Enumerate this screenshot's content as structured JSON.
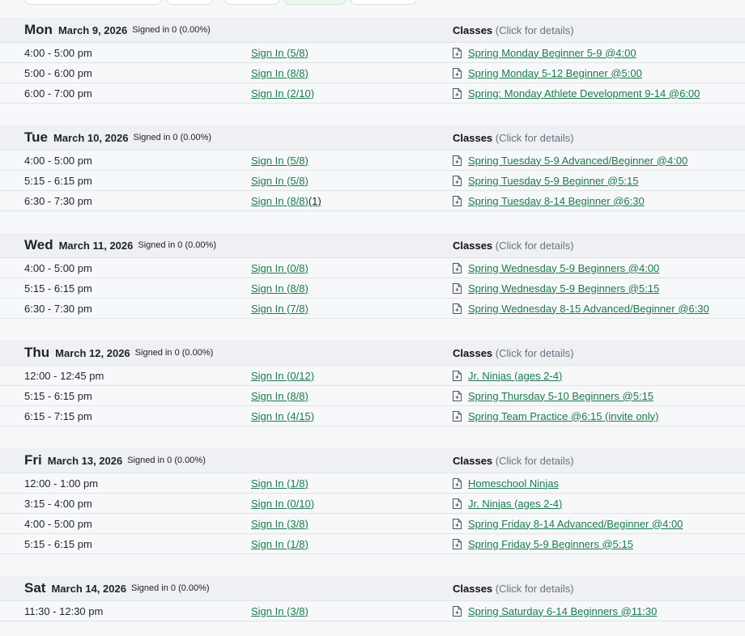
{
  "classes_label": "Classes",
  "classes_hint": "(Click for details)",
  "days": [
    {
      "name": "Mon",
      "date": "March 9, 2026",
      "signed": "Signed in 0 (0.00%)",
      "rows": [
        {
          "time": "4:00 - 5:00 pm",
          "signin": "Sign In (5/8)",
          "extra": "",
          "class": "Spring Monday Beginner 5-9 @4:00"
        },
        {
          "time": "5:00 - 6:00 pm",
          "signin": "Sign In (8/8)",
          "extra": "",
          "class": "Spring Monday 5-12 Beginner @5:00"
        },
        {
          "time": "6:00 - 7:00 pm",
          "signin": "Sign In (2/10)",
          "extra": "",
          "class": "Spring: Monday Athlete Development 9-14 @6:00"
        }
      ]
    },
    {
      "name": "Tue",
      "date": "March 10, 2026",
      "signed": "Signed in 0 (0.00%)",
      "rows": [
        {
          "time": "4:00 - 5:00 pm",
          "signin": "Sign In (5/8)",
          "extra": "",
          "class": "Spring Tuesday 5-9 Advanced/Beginner @4:00"
        },
        {
          "time": "5:15 - 6:15 pm",
          "signin": "Sign In (5/8)",
          "extra": "",
          "class": "Spring Tuesday 5-9 Beginner @5:15"
        },
        {
          "time": "6:30 - 7:30 pm",
          "signin": "Sign In (8/8)",
          "extra": "(1)",
          "class": "Spring Tuesday 8-14 Beginner @6:30"
        }
      ]
    },
    {
      "name": "Wed",
      "date": "March 11, 2026",
      "signed": "Signed in 0 (0.00%)",
      "rows": [
        {
          "time": "4:00 - 5:00 pm",
          "signin": "Sign In (0/8)",
          "extra": "",
          "class": "Spring Wednesday 5-9 Beginners @4:00"
        },
        {
          "time": "5:15 - 6:15 pm",
          "signin": "Sign In (8/8)",
          "extra": "",
          "class": "Spring Wednesday 5-9 Beginners @5:15"
        },
        {
          "time": "6:30 - 7:30 pm",
          "signin": "Sign In (7/8)",
          "extra": "",
          "class": "Spring Wednesday 8-15 Advanced/Beginner @6:30"
        }
      ]
    },
    {
      "name": "Thu",
      "date": "March 12, 2026",
      "signed": "Signed in 0 (0.00%)",
      "rows": [
        {
          "time": "12:00 - 12:45 pm",
          "signin": "Sign In (0/12)",
          "extra": "",
          "class": "Jr. Ninjas (ages 2-4)"
        },
        {
          "time": "5:15 - 6:15 pm",
          "signin": "Sign In (8/8)",
          "extra": "",
          "class": "Spring Thursday 5-10 Beginners @5:15"
        },
        {
          "time": "6:15 - 7:15 pm",
          "signin": "Sign In (4/15)",
          "extra": "",
          "class": "Spring Team Practice @6:15 (invite only)"
        }
      ]
    },
    {
      "name": "Fri",
      "date": "March 13, 2026",
      "signed": "Signed in 0 (0.00%)",
      "rows": [
        {
          "time": "12:00 - 1:00 pm",
          "signin": "Sign In (1/8)",
          "extra": "",
          "class": "Homeschool Ninjas"
        },
        {
          "time": "3:15 - 4:00 pm",
          "signin": "Sign In (0/10)",
          "extra": "",
          "class": "Jr. Ninjas (ages 2-4)"
        },
        {
          "time": "4:00 - 5:00 pm",
          "signin": "Sign In (3/8)",
          "extra": "",
          "class": "Spring Friday 8-14 Advanced/Beginner @4:00"
        },
        {
          "time": "5:15 - 6:15 pm",
          "signin": "Sign In (1/8)",
          "extra": "",
          "class": "Spring Friday 5-9 Beginners @5:15"
        }
      ]
    },
    {
      "name": "Sat",
      "date": "March 14, 2026",
      "signed": "Signed in 0 (0.00%)",
      "rows": [
        {
          "time": "11:30 - 12:30 pm",
          "signin": "Sign In (3/8)",
          "extra": "",
          "class": "Spring Saturday 6-14 Beginners @11:30"
        }
      ]
    }
  ]
}
